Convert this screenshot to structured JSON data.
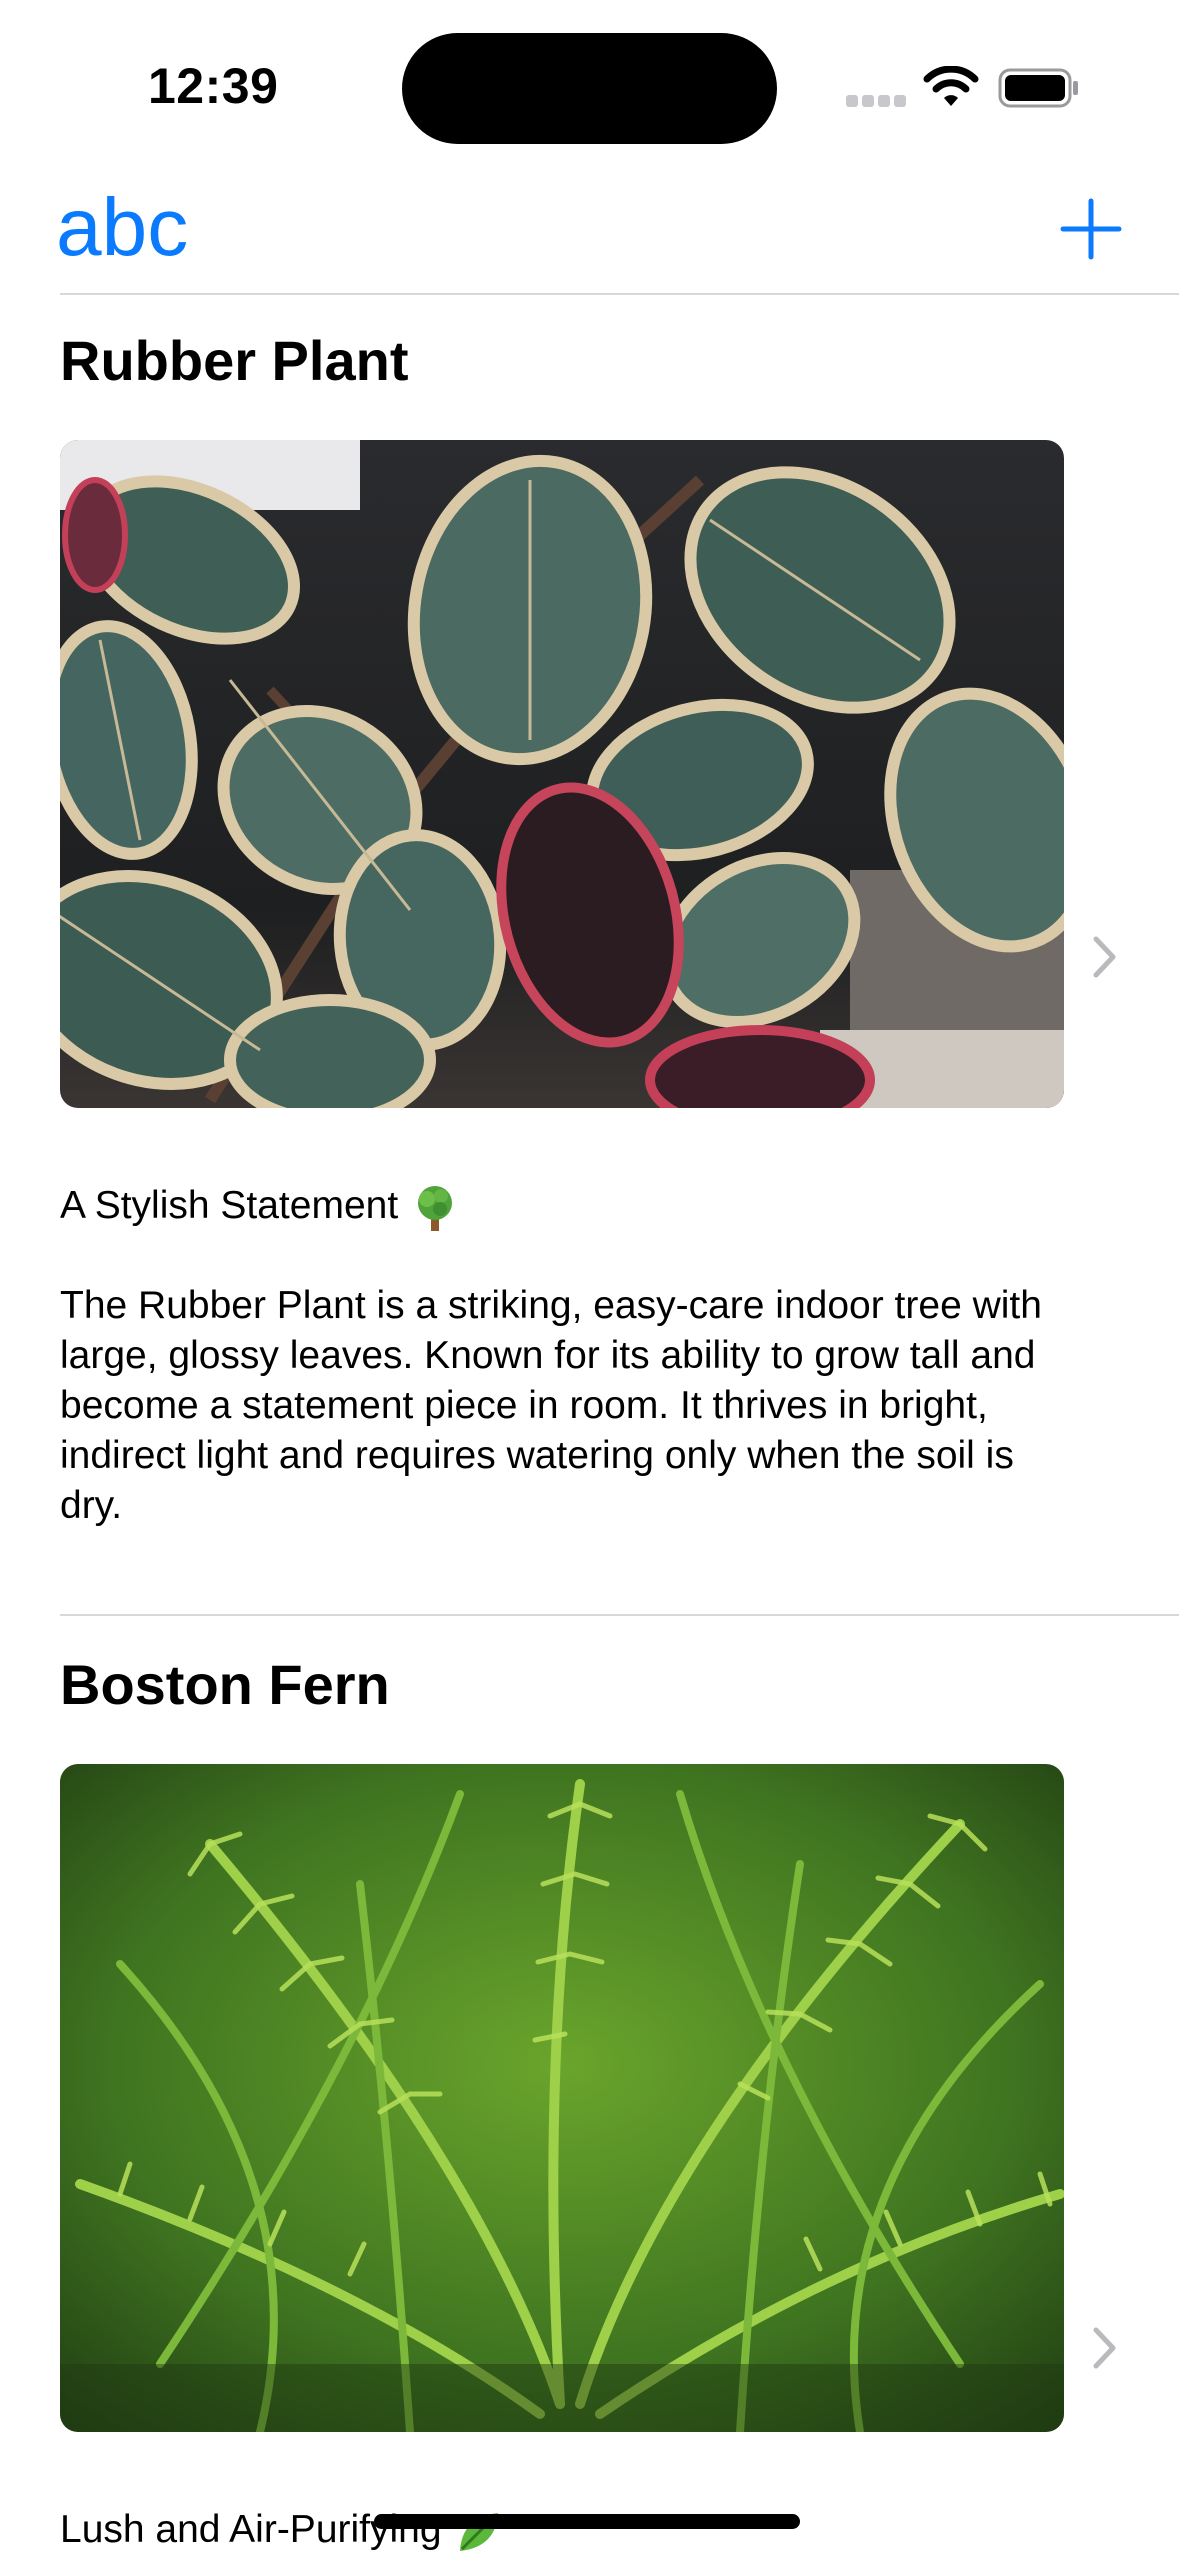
{
  "status_bar": {
    "time": "12:39",
    "icons": [
      "signal-dots-icon",
      "wifi-icon",
      "battery-icon"
    ]
  },
  "nav": {
    "title": "abc",
    "add_icon": "plus-icon",
    "accent_color": "#0a7aff"
  },
  "plants": [
    {
      "name": "Rubber Plant",
      "photo": "rubber-plant-photo",
      "tagline": "A Stylish Statement",
      "tagline_emoji_icon": "tree-emoji-icon",
      "description": "The Rubber Plant is a striking, easy-care indoor tree with large, glossy leaves. Known for its ability to grow tall and become a statement piece in room. It thrives in bright, indirect light and requires watering only when the soil is dry."
    },
    {
      "name": "Boston Fern",
      "photo": "boston-fern-photo",
      "tagline": "Lush and Air-Purifying",
      "tagline_emoji_icon": "leaf-emoji-icon",
      "description": ""
    }
  ]
}
